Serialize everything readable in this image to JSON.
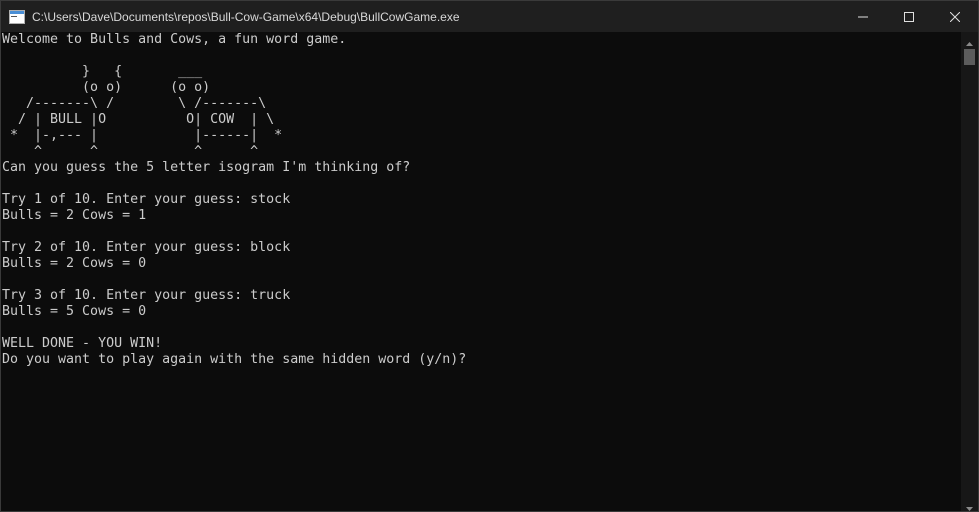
{
  "window": {
    "title": "C:\\Users\\Dave\\Documents\\repos\\Bull-Cow-Game\\x64\\Debug\\BullCowGame.exe",
    "app_icon": "console-app-icon",
    "buttons": {
      "minimize_icon": "minimize-icon",
      "maximize_icon": "maximize-icon",
      "close_icon": "close-icon"
    }
  },
  "console": {
    "lines": [
      "Welcome to Bulls and Cows, a fun word game.",
      "",
      "          }   {       ___",
      "          (o o)      (o o)",
      "   /-------\\ /        \\ /-------\\",
      "  / | BULL |O          O| COW  | \\",
      " *  |-,--- |            |------|  *",
      "    ^      ^            ^      ^",
      "Can you guess the 5 letter isogram I'm thinking of?",
      "",
      "Try 1 of 10. Enter your guess: stock",
      "Bulls = 2 Cows = 1",
      "",
      "Try 2 of 10. Enter your guess: block",
      "Bulls = 2 Cows = 0",
      "",
      "Try 3 of 10. Enter your guess: truck",
      "Bulls = 5 Cows = 0",
      "",
      "WELL DONE - YOU WIN!",
      "Do you want to play again with the same hidden word (y/n)?"
    ]
  },
  "colors": {
    "console_bg": "#0c0c0c",
    "console_text": "#cccccc",
    "titlebar_bg": "#1f1f1f"
  }
}
